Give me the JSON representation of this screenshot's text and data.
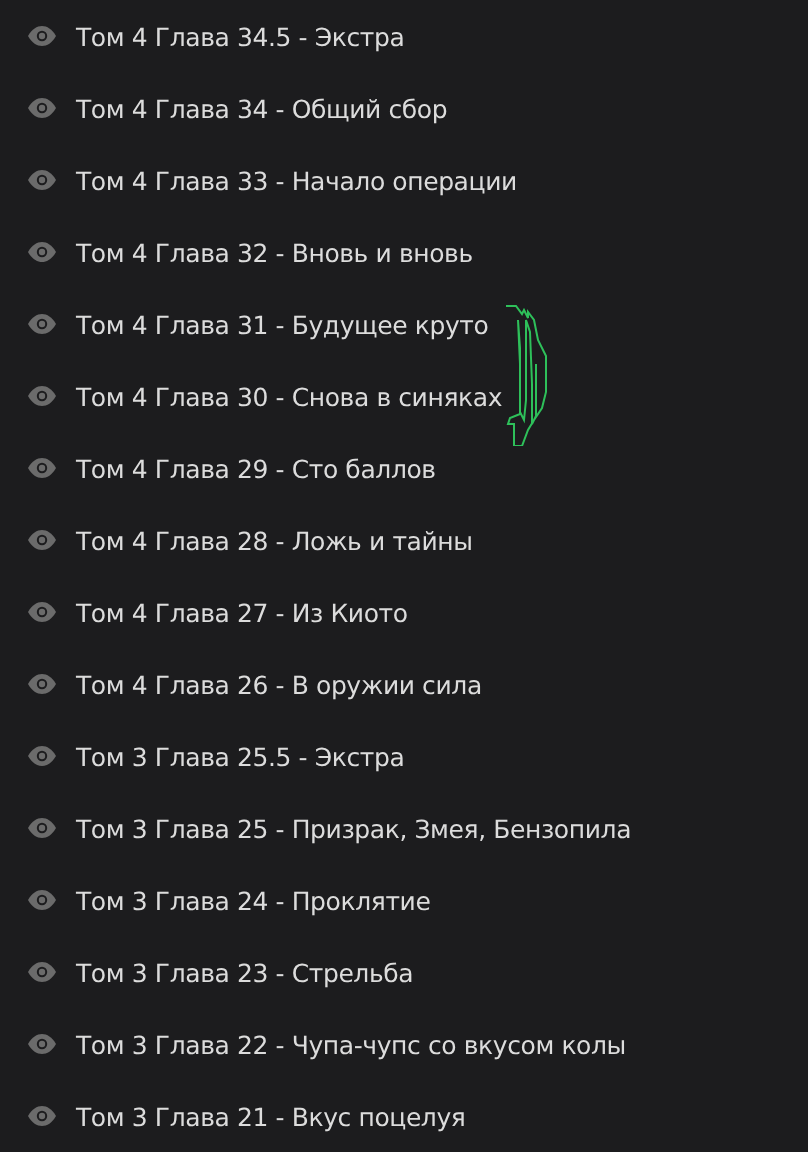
{
  "chapters": [
    {
      "title": "Том 4 Глава 34.5 - Экстра"
    },
    {
      "title": "Том 4 Глава 34 - Общий сбор"
    },
    {
      "title": "Том 4 Глава 33 - Начало операции"
    },
    {
      "title": "Том 4 Глава 32 - Вновь и вновь"
    },
    {
      "title": "Том 4 Глава 31 - Будущее круто"
    },
    {
      "title": "Том 4 Глава 30 - Снова в синяках"
    },
    {
      "title": "Том 4 Глава 29 - Сто баллов"
    },
    {
      "title": "Том 4 Глава 28 - Ложь и тайны"
    },
    {
      "title": "Том 4 Глава 27 - Из Киото"
    },
    {
      "title": "Том 4 Глава 26 - В оружии сила"
    },
    {
      "title": "Том 3 Глава 25.5 - Экстра"
    },
    {
      "title": "Том 3 Глава 25 - Призрак, Змея, Бензопила"
    },
    {
      "title": "Том 3 Глава 24 - Проклятие"
    },
    {
      "title": "Том 3 Глава 23 - Стрельба"
    },
    {
      "title": "Том 3 Глава 22 - Чупа-чупс со вкусом колы"
    },
    {
      "title": "Том 3 Глава 21 - Вкус поцелуя"
    }
  ]
}
